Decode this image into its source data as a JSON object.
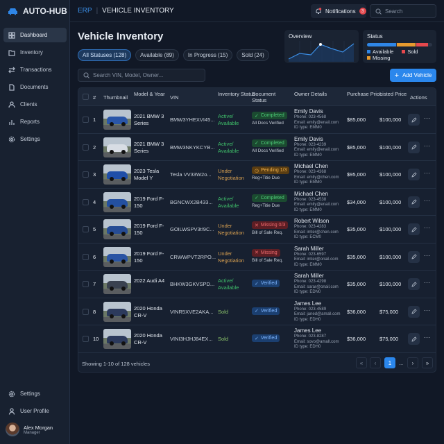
{
  "app": {
    "name": "AUTO-HUB",
    "section": "ERP",
    "page": "VEHICLE INVENTORY"
  },
  "sidebar": {
    "items": [
      {
        "label": "Dashboard",
        "icon": "grid-icon",
        "active": true
      },
      {
        "label": "Inventory",
        "icon": "folder-icon"
      },
      {
        "label": "Transactions",
        "icon": "arrows-icon"
      },
      {
        "label": "Documents",
        "icon": "document-icon"
      },
      {
        "label": "Clients",
        "icon": "users-icon"
      },
      {
        "label": "Reports",
        "icon": "bar-chart-icon"
      },
      {
        "label": "Settings",
        "icon": "gear-icon"
      }
    ],
    "bottom": [
      {
        "label": "Settings",
        "icon": "gear-icon"
      },
      {
        "label": "User Profile",
        "icon": "user-icon"
      }
    ],
    "user": {
      "name": "Alex Morgan",
      "role": "Manager"
    }
  },
  "header": {
    "notifications_label": "Notifications",
    "notifications_count": "3",
    "search_placeholder": "Search"
  },
  "main": {
    "title": "Vehicle Inventory",
    "filters": [
      "All Statuses (128)",
      "Available (89)",
      "In Progress (15)",
      "Sold (24)"
    ],
    "search_placeholder": "Search VIN, Model, Owner...",
    "add_label": "Add Vehicle",
    "overview": {
      "title": "Overview"
    },
    "status_card": {
      "title": "Status",
      "segments": [
        {
          "label": "Available",
          "color": "#2f86e6",
          "fraction": 0.45
        },
        {
          "label": "Missing",
          "color": "#e69a2e",
          "fraction": 0.28
        },
        {
          "label": "Sold",
          "color": "#e5484d",
          "fraction": 0.18
        }
      ]
    }
  },
  "table": {
    "headers": [
      "#",
      "Thumbnail",
      "Model & Year",
      "VIN",
      "Inventory Status",
      "Document Status",
      "Owner Details",
      "Purchase Price",
      "Listed Price",
      "Actions"
    ],
    "rows": [
      {
        "n": "1",
        "model": "2021 BMW 3 Series",
        "vin": "BMW3YHEXVI45...",
        "inv": "Active/ Available",
        "doc": "Completed",
        "docsub": "All Docs Verified",
        "name": "Emily Davis",
        "phone": "Phone: 023-4568",
        "email": "Email: emily@enail.com",
        "id": "ID type: EMM0",
        "buy": "$85,000",
        "list": "$100,000",
        "car": "#2a56a8"
      },
      {
        "n": "2",
        "model": "2021 BMW 3 Series",
        "vin": "BMW3NKYKCYB...",
        "inv": "Active/ Available",
        "doc": "Completed",
        "docsub": "All Docs Verified",
        "name": "Emily Davis",
        "phone": "Phone: 023-4239",
        "email": "Email: emily@enail.com",
        "id": "ID type: EMM0",
        "buy": "$85,000",
        "list": "$100,000",
        "car": "#d8dde4"
      },
      {
        "n": "3",
        "model": "2023 Tesla Model Y",
        "vin": "Tesla VV33W2o...",
        "inv": "Under Negotiation",
        "doc": "Pending 1/3",
        "docsub": "Reg+Titie Due",
        "name": "Michael Chen",
        "phone": "Phone: 023-4368",
        "email": "Email: emily@chen.com",
        "id": "ID type: EMM0",
        "buy": "$95,000",
        "list": "$100,000",
        "car": "#1f4fa8"
      },
      {
        "n": "4",
        "model": "2019 Ford F-150",
        "vin": "BGNCWX2B433...",
        "inv": "Active/ Available",
        "doc": "Completed",
        "docsub": "Reg+Titie Due",
        "name": "Michael Chen",
        "phone": "Phone: 023-4538",
        "email": "Email: emily@enail.com",
        "id": "ID type: EMM0",
        "buy": "$34,000",
        "list": "$100,000",
        "car": "#2450a0"
      },
      {
        "n": "5",
        "model": "2019 Ford F-150",
        "vin": "GOILWSPV3t!9C...",
        "inv": "Under Negotiation",
        "doc": "Missing 0/3",
        "docsub": "Bill of Sale Req.",
        "name": "Robert Wilson",
        "phone": "Phone: 023-4283",
        "email": "Email: imter@chen.com",
        "id": "ID type: ECM0",
        "buy": "$35,000",
        "list": "$100,000",
        "car": "#264c94"
      },
      {
        "n": "6",
        "model": "2019 Ford F-150",
        "vin": "CRWWPVT2RPO...",
        "inv": "Under Negotiation",
        "doc": "Missing",
        "docsub": "Bill of Sale Req.",
        "name": "Sarah Miller",
        "phone": "Phone: 023-6597",
        "email": "Email: imter@onail.com",
        "id": "ID type: EMM0",
        "buy": "$35,000",
        "list": "$100,000",
        "car": "#2a54a4"
      },
      {
        "n": "7",
        "model": "2022 Audi A4",
        "vin": "BHKW3GKVSPD...",
        "inv": "Active/ Available",
        "doc": "Verified",
        "docsub": "",
        "name": "Sarah Miller",
        "phone": "Phone: 023-4298",
        "email": "Email: sarar@onail.com",
        "id": "ID type: EDN0",
        "buy": "$35,000",
        "list": "$100,000",
        "car": "#3a4250"
      },
      {
        "n": "8",
        "model": "2020 Honda CR-V",
        "vin": "VINR5XVE2AKA...",
        "inv": "Sold",
        "doc": "Verified",
        "docsub": "",
        "name": "James Lee",
        "phone": "Phone: 023-4589",
        "email": "Email: janed@amall.com",
        "id": "ID type: EDH0",
        "buy": "$36,000",
        "list": "$75,000",
        "car": "#2c3a5c"
      },
      {
        "n": "10",
        "model": "2020 Honda CR-V",
        "vin": "VINI3HJHJ84EX...",
        "inv": "Sold",
        "doc": "Verified",
        "docsub": "",
        "name": "James Lee",
        "phone": "Phone: 023-8287",
        "email": "Email: sovo@amall.com",
        "id": "ID type: EDH0",
        "buy": "$36,000",
        "list": "$75,000",
        "car": "#2c3a5c"
      }
    ]
  },
  "pagination": {
    "summary": "Showing 1-10 of 128 vehicles",
    "current": "1",
    "ellipsis": "..."
  },
  "colors": {
    "accent": "#2b87ec",
    "available": "#3fbf6a",
    "negotiation": "#d9a050",
    "sold": "#8cc36a"
  }
}
